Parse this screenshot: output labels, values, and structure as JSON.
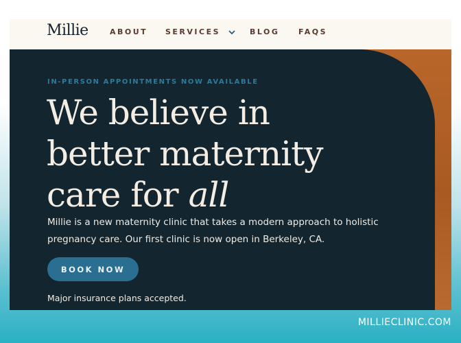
{
  "nav": {
    "logo": "Millie",
    "items": [
      "ABOUT",
      "SERVICES",
      "BLOG",
      "FAQS"
    ]
  },
  "hero": {
    "eyebrow": "IN-PERSON APPOINTMENTS NOW AVAILABLE",
    "headline_line1": "We believe in",
    "headline_line2": "better maternity",
    "headline_line3_prefix": "care for ",
    "headline_line3_italic": "all",
    "description": "Millie is a new maternity clinic that takes a modern approach to holistic pregnancy care. Our first clinic is now open in Berkeley, CA.",
    "cta_label": "BOOK NOW",
    "footnote": "Major insurance plans accepted."
  },
  "watermark": "MILLIECLINIC.COM",
  "colors": {
    "hero_bg": "#13252f",
    "accent_copper": "#b0622a",
    "cta": "#2a6f91",
    "nav_bg": "#fbf7f1",
    "nav_text": "#5a3b2e"
  },
  "icons": {
    "services_dropdown": "chevron-down-icon"
  }
}
